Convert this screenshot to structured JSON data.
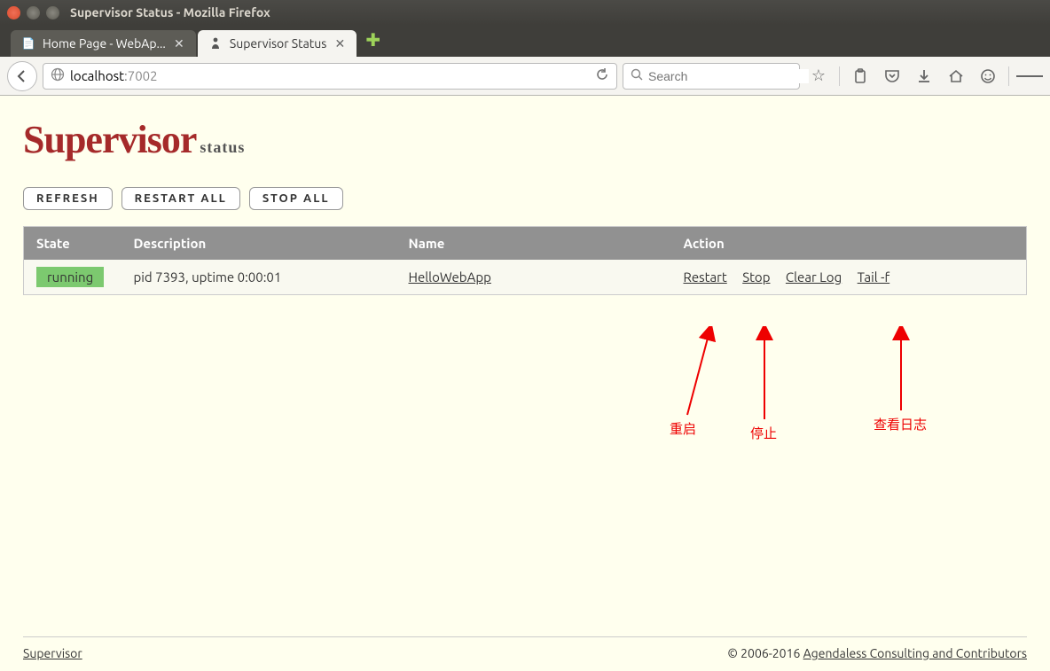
{
  "window": {
    "title": "Supervisor Status - Mozilla Firefox"
  },
  "tabs": [
    {
      "label": "Home Page - WebAp...",
      "active": false
    },
    {
      "label": "Supervisor Status",
      "active": true
    }
  ],
  "url": {
    "host": "localhost",
    "port": ":7002"
  },
  "search": {
    "placeholder": "Search"
  },
  "logo": {
    "main": "Supervisor",
    "sub": "status"
  },
  "buttons": {
    "refresh": "REFRESH",
    "restart_all": "RESTART ALL",
    "stop_all": "STOP ALL"
  },
  "table": {
    "headers": {
      "state": "State",
      "description": "Description",
      "name": "Name",
      "action": "Action"
    },
    "rows": [
      {
        "state": "running",
        "description": "pid 7393, uptime 0:00:01",
        "name": "HelloWebApp",
        "restart": "Restart",
        "stop": "Stop",
        "clearlog": "Clear Log",
        "tailf": "Tail -f"
      }
    ]
  },
  "annotations": {
    "restart": "重启",
    "stop": "停止",
    "viewlog": "查看日志"
  },
  "footer": {
    "link": "Supervisor",
    "copyright": "© 2006-2016 ",
    "copyright_link": "Agendaless Consulting and Contributors"
  }
}
